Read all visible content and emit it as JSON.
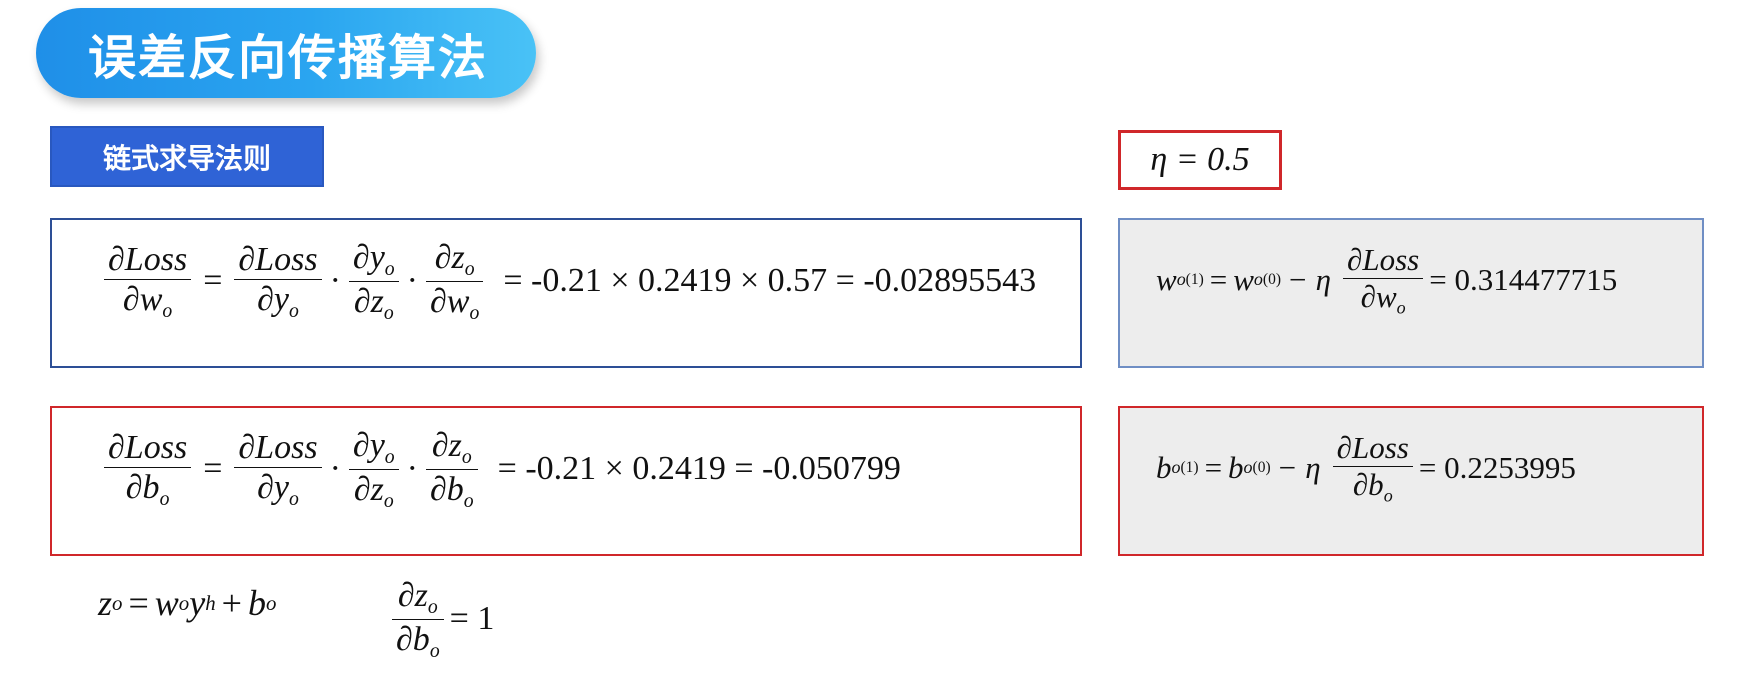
{
  "title": "误差反向传播算法",
  "subtitle": "链式求导法则",
  "eta_label": "η = 0.5",
  "eq_w": {
    "lhs_num": "∂Loss",
    "lhs_den_sym": "∂w",
    "f1_num": "∂Loss",
    "f1_den_sym": "∂y",
    "f2_num_sym": "∂y",
    "f2_den_sym": "∂z",
    "f3_num_sym": "∂z",
    "f3_den_sym": "∂w",
    "sub": "o",
    "result": "= -0.21 × 0.2419 × 0.57 = -0.02895543"
  },
  "eq_b": {
    "lhs_num": "∂Loss",
    "lhs_den_sym": "∂b",
    "f1_num": "∂Loss",
    "f1_den_sym": "∂y",
    "f2_num_sym": "∂y",
    "f2_den_sym": "∂z",
    "f3_num_sym": "∂z",
    "f3_den_sym": "∂b",
    "sub": "o",
    "result": "= -0.21 × 0.2419 = -0.050799"
  },
  "update_w": {
    "var": "w",
    "sub": "o",
    "sup_new": "(1)",
    "sup_old": "(0)",
    "eta_part": "− η",
    "grad_num": "∂Loss",
    "grad_den_sym": "∂w",
    "result": "= 0.314477715"
  },
  "update_b": {
    "var": "b",
    "sub": "o",
    "sup_new": "(1)",
    "sup_old": "(0)",
    "eta_part": "− η",
    "grad_num": "∂Loss",
    "grad_den_sym": "∂b",
    "result": "= 0.2253995"
  },
  "bottom": {
    "z": "z",
    "z_sub": "o",
    "w": "w",
    "w_sub": "o",
    "y": "y",
    "y_sub": "h",
    "b": "b",
    "b_sub": "o",
    "frac_num": "∂z",
    "frac_num_sub": "o",
    "frac_den": "∂b",
    "frac_den_sub": "o",
    "frac_result": "= 1"
  }
}
